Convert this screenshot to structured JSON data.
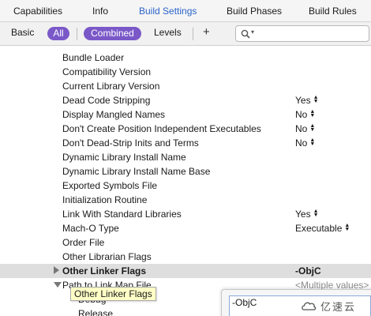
{
  "tabs": [
    {
      "label": "Capabilities",
      "active": false
    },
    {
      "label": "Info",
      "active": false
    },
    {
      "label": "Build Settings",
      "active": true
    },
    {
      "label": "Build Phases",
      "active": false
    },
    {
      "label": "Build Rules",
      "active": false
    }
  ],
  "filter": {
    "basic_label": "Basic",
    "all_label": "All",
    "combined_label": "Combined",
    "levels_label": "Levels",
    "add_label": "+",
    "search_value": "",
    "search_placeholder": ""
  },
  "settings": [
    {
      "name": "Bundle Loader",
      "value": ""
    },
    {
      "name": "Compatibility Version",
      "value": ""
    },
    {
      "name": "Current Library Version",
      "value": ""
    },
    {
      "name": "Dead Code Stripping",
      "value": "Yes",
      "stepper": true
    },
    {
      "name": "Display Mangled Names",
      "value": "No",
      "stepper": true
    },
    {
      "name": "Don't Create Position Independent Executables",
      "value": "No",
      "stepper": true
    },
    {
      "name": "Don't Dead-Strip Inits and Terms",
      "value": "No",
      "stepper": true
    },
    {
      "name": "Dynamic Library Install Name",
      "value": ""
    },
    {
      "name": "Dynamic Library Install Name Base",
      "value": ""
    },
    {
      "name": "Exported Symbols File",
      "value": ""
    },
    {
      "name": "Initialization Routine",
      "value": ""
    },
    {
      "name": "Link With Standard Libraries",
      "value": "Yes",
      "stepper": true
    },
    {
      "name": "Mach-O Type",
      "value": "Executable",
      "stepper": true
    },
    {
      "name": "Order File",
      "value": ""
    },
    {
      "name": "Other Librarian Flags",
      "value": ""
    },
    {
      "name": "Other Linker Flags",
      "value": "-ObjC",
      "selected": true
    },
    {
      "name": "Path to Link Map File",
      "value": "<Multiple values>",
      "expanded": true
    },
    {
      "name": "Debug",
      "value": "",
      "sub": true
    },
    {
      "name": "Release",
      "value": "",
      "sub": true
    }
  ],
  "tooltip_text": "Other Linker Flags",
  "popover": {
    "editor_value": "-ObjC"
  },
  "watermark": {
    "text": "亿速云"
  },
  "colors": {
    "accent": "#2a64c8",
    "pill": "#7a58c8",
    "selected_row": "#dedede",
    "tooltip_bg": "#ffffc6"
  }
}
